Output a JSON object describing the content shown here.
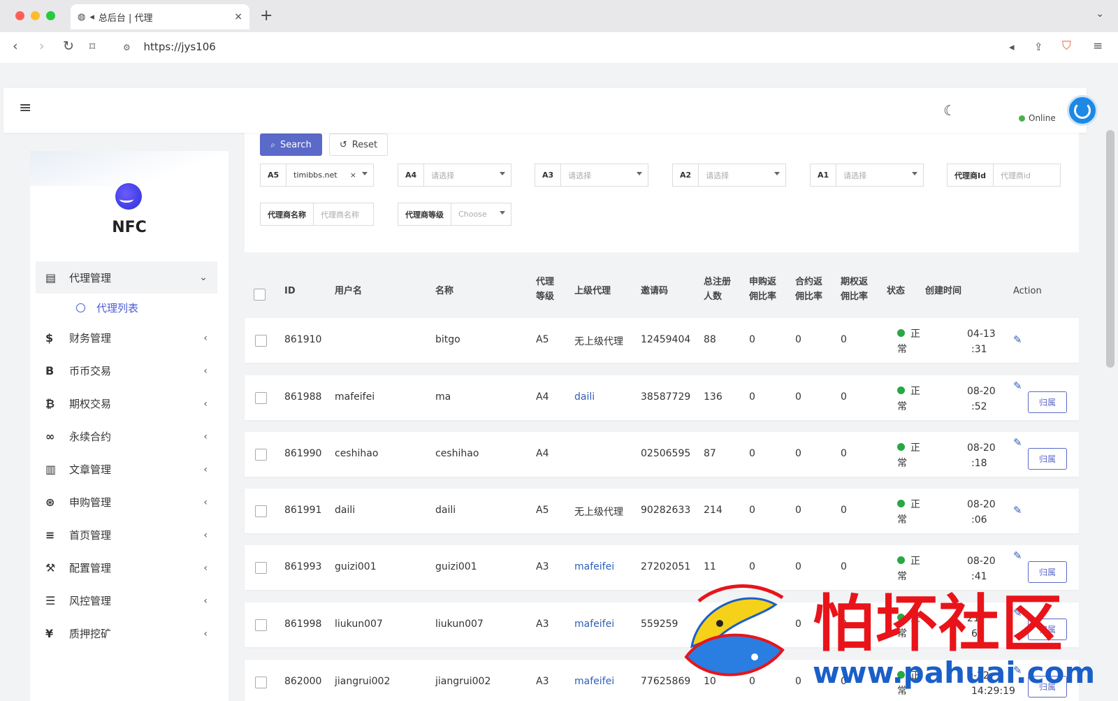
{
  "browser": {
    "tab_title": "总后台 | 代理",
    "url": "https://jys106",
    "new_tab": "+",
    "close": "×"
  },
  "header": {
    "status": "Online"
  },
  "sidebar": {
    "brand": "NFC",
    "items": [
      {
        "label": "代理管理",
        "icon": "id-card-icon",
        "glyph": "▤"
      },
      {
        "label": "财务管理",
        "icon": "dollar-icon",
        "glyph": "$"
      },
      {
        "label": "币币交易",
        "icon": "b-icon",
        "glyph": "B"
      },
      {
        "label": "期权交易",
        "icon": "bitcoin-icon",
        "glyph": "₿"
      },
      {
        "label": "永续合约",
        "icon": "link-icon",
        "glyph": "∞"
      },
      {
        "label": "文章管理",
        "icon": "newspaper-icon",
        "glyph": "▥"
      },
      {
        "label": "申购管理",
        "icon": "lifebuoy-icon",
        "glyph": "⊛"
      },
      {
        "label": "首页管理",
        "icon": "list-icon",
        "glyph": "≡"
      },
      {
        "label": "配置管理",
        "icon": "wrench-icon",
        "glyph": "⚒"
      },
      {
        "label": "风控管理",
        "icon": "outdent-icon",
        "glyph": "☰"
      },
      {
        "label": "质押挖矿",
        "icon": "yen-icon",
        "glyph": "¥"
      }
    ],
    "sub_item": "代理列表"
  },
  "filters": {
    "search_label": "Search",
    "reset_label": "Reset",
    "a5_label": "A5",
    "a5_value": "timibbs.net",
    "a4_label": "A4",
    "a3_label": "A3",
    "a2_label": "A2",
    "a1_label": "A1",
    "select_placeholder": "请选择",
    "agent_id_label": "代理商Id",
    "agent_id_placeholder": "代理商id",
    "agent_name_label": "代理商名称",
    "agent_name_placeholder": "代理商名称",
    "agent_level_label": "代理商等级",
    "agent_level_placeholder": "Choose"
  },
  "table": {
    "headers": {
      "id": "ID",
      "username": "用户名",
      "name": "名称",
      "level_1": "代理",
      "level_2": "等级",
      "parent": "上级代理",
      "invite": "邀请码",
      "reg_1": "总注册",
      "reg_2": "人数",
      "sub_1": "申购返",
      "sub_2": "佣比率",
      "contract_1": "合约返",
      "contract_2": "佣比率",
      "option_1": "期权返",
      "option_2": "佣比率",
      "status": "状态",
      "created": "创建时间",
      "action": "Action"
    },
    "status_line1": "正",
    "status_line2": "常",
    "assign_label": "归属",
    "rows": [
      {
        "id": "861910",
        "username": "",
        "name": "bitgo",
        "level": "A5",
        "parent": "无上级代理",
        "parent_link": false,
        "invite": "12459404",
        "reg": "88",
        "sub": "0",
        "contract": "0",
        "option": "0",
        "time1": "04-13",
        "time2": ":31",
        "assign": false
      },
      {
        "id": "861988",
        "username": "mafeifei",
        "name": "ma",
        "level": "A4",
        "parent": "daili",
        "parent_link": true,
        "invite": "38587729",
        "reg": "136",
        "sub": "0",
        "contract": "0",
        "option": "0",
        "time1": "08-20",
        "time2": ":52",
        "assign": true
      },
      {
        "id": "861990",
        "username": "ceshihao",
        "name": "ceshihao",
        "level": "A4",
        "parent": "",
        "parent_link": false,
        "invite": "02506595",
        "reg": "87",
        "sub": "0",
        "contract": "0",
        "option": "0",
        "time1": "08-20",
        "time2": ":18",
        "assign": true
      },
      {
        "id": "861991",
        "username": "daili",
        "name": "daili",
        "level": "A5",
        "parent": "无上级代理",
        "parent_link": false,
        "invite": "90282633",
        "reg": "214",
        "sub": "0",
        "contract": "0",
        "option": "0",
        "time1": "08-20",
        "time2": ":06",
        "assign": false
      },
      {
        "id": "861993",
        "username": "guizi001",
        "name": "guizi001",
        "level": "A3",
        "parent": "mafeifei",
        "parent_link": true,
        "invite": "27202051",
        "reg": "11",
        "sub": "0",
        "contract": "0",
        "option": "0",
        "time1": "08-20",
        "time2": ":41",
        "assign": true
      },
      {
        "id": "861998",
        "username": "liukun007",
        "name": "liukun007",
        "level": "A3",
        "parent": "mafeifei",
        "parent_link": true,
        "invite": "559259",
        "reg": "",
        "sub": "",
        "contract": "0",
        "option": "0",
        "time1": "21",
        "time2": "6",
        "assign": true
      },
      {
        "id": "862000",
        "username": "jiangrui002",
        "name": "jiangrui002",
        "level": "A3",
        "parent": "mafeifei",
        "parent_link": true,
        "invite": "77625869",
        "reg": "10",
        "sub": "0",
        "contract": "0",
        "option": "0",
        "time1": "0-22",
        "time2": "14:29:19",
        "assign": true
      }
    ]
  },
  "watermark": {
    "text": "怕坏社区",
    "url": "www.pahuai.com"
  },
  "colors": {
    "accent": "#5b69c8",
    "link": "#2f5fb8",
    "status_green": "#27a844",
    "watermark_red": "#e8141a",
    "watermark_blue": "#1a5fc8"
  }
}
